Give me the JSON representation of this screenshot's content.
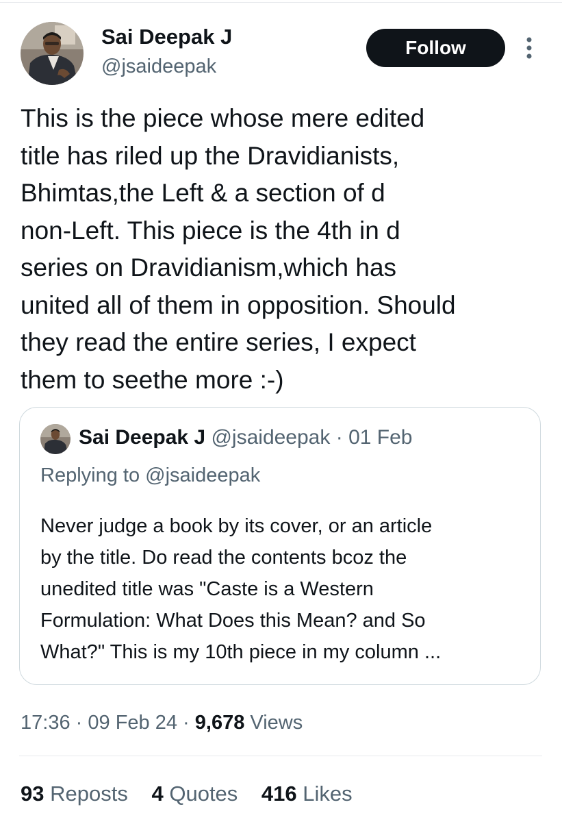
{
  "colors": {
    "text_primary": "#0f1419",
    "text_secondary": "#536471",
    "follow_button_bg": "#0f1419",
    "follow_button_text": "#ffffff",
    "border": "#cfd9de"
  },
  "author": {
    "name": "Sai Deepak J",
    "handle": "@jsaideepak",
    "avatar_icon": "profile-photo"
  },
  "follow_label": "Follow",
  "more_icon": "vertical-ellipsis-icon",
  "tweet": {
    "text": "This is the piece whose mere edited\ntitle has riled up the Dravidianists,\nBhimtas,the Left & a section of d\nnon-Left. This piece is the 4th in d\nseries on Dravidianism,which has\nunited all of them in opposition. Should\nthey read the entire series, I expect\nthem to seethe more :-)"
  },
  "quote": {
    "name": "Sai Deepak J",
    "handle": "@jsaideepak",
    "separator": "·",
    "date": "01 Feb",
    "replying_to": "Replying to @jsaideepak",
    "text": "Never judge a book by its cover, or an article\nby the title. Do read the contents bcoz the\nunedited title was \"Caste is a Western\nFormulation: What Does this Mean? and So\nWhat?\" This is my 10th piece in my column ..."
  },
  "meta": {
    "time": "17:36",
    "separator": "·",
    "date": "09 Feb 24",
    "views_count": "9,678",
    "views_label": "Views"
  },
  "stats": [
    {
      "count": "93",
      "label": "Reposts"
    },
    {
      "count": "4",
      "label": "Quotes"
    },
    {
      "count": "416",
      "label": "Likes"
    }
  ]
}
